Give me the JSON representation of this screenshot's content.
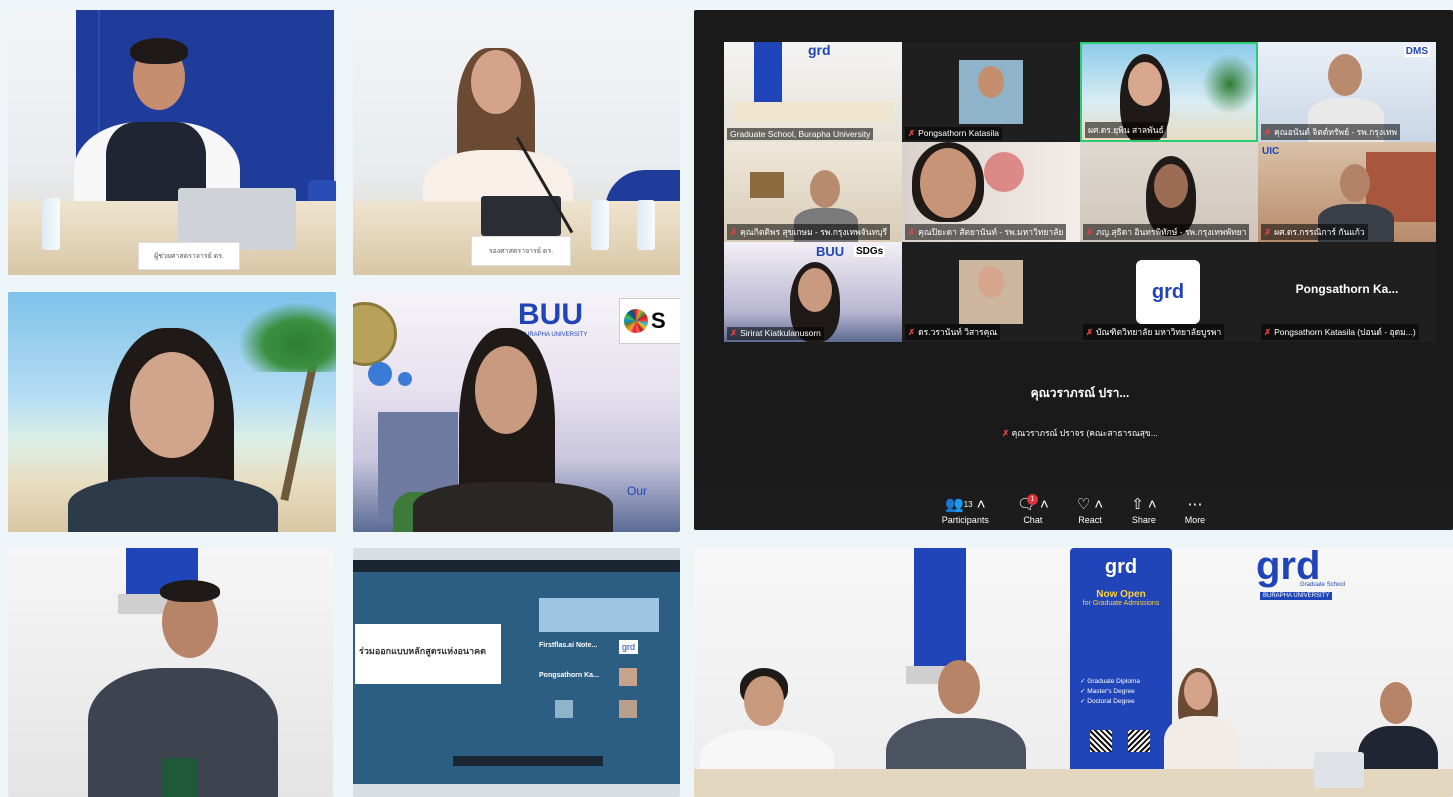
{
  "tiles": {
    "tl_nameplate": "ผู้ช่วยศาสตราจารย์ ดร.",
    "tm_nameplate": "รองศาสตราจารย์ ดร.",
    "buu_logo_text": "BUU",
    "buu_sub": "BURAPHA UNIVERSITY",
    "buu_sdg": "S",
    "buu_our": "Our"
  },
  "zoom": {
    "participants": [
      {
        "name": "Graduate School, Burapha University"
      },
      {
        "name": "Pongsathorn Katasila"
      },
      {
        "name": "ผศ.ดร.ยุพิน สาลพันธ์"
      },
      {
        "name": "คุณอนันต์ จิตต์ทรัพย์ - รพ.กรุงเทพ"
      },
      {
        "name": "คุณกิตติพร สุขเกษม - รพ.กรุงเทพจันทบุรี"
      },
      {
        "name": "คุณปิยะดา สัตยานันท์ - รพ.มหาวิทยาลัย"
      },
      {
        "name": "ภญ.สุธิดา อินทรพิทักษ์ - รพ.กรุงเทพพัทยา"
      },
      {
        "name": "ผศ.ดร.กรรณิการ์ กันแก้ว"
      },
      {
        "name": "Sirirat Kiatkulanusorn"
      },
      {
        "name": "ดร.วรานันท์ วิสารคุณ"
      },
      {
        "name": "บัณฑิตวิทยาลัย มหาวิทยาลัยบูรพา"
      },
      {
        "name": "Pongsathorn Katasila (ปอนด์ - อุดม...)"
      }
    ],
    "big_name_1": "Pongsathorn  Ka...",
    "center_name": "คุณวราภรณ์ ปรา...",
    "center_label": "คุณวราภรณ์ ปราจร (คณะสาธารณสุข...",
    "grd_logo": "grd",
    "dms_logo": "DMS",
    "uic_logo": "UIC",
    "sdgs_logo": "SDGs",
    "buu_logo": "BUU",
    "toolbar": {
      "participants_label": "Participants",
      "participants_count": "13",
      "chat_label": "Chat",
      "chat_badge": "1",
      "react_label": "React",
      "share_label": "Share",
      "more_label": "More"
    }
  },
  "tv": {
    "slide_title": "ร่วมออกแบบหลักสูตรแห่งอนาคต",
    "name1": "Firstflas.ai  Note...",
    "name2": "Pongsathorn  Ka...",
    "grd": "grd"
  },
  "room": {
    "banner_logo": "grd",
    "banner_title": "Now Open",
    "banner_sub": "for Graduate Admissions",
    "banner_list": [
      "Graduate Diploma",
      "Master's Degree",
      "Doctoral Degree"
    ],
    "wall_logo": "grd",
    "wall_sub1": "Graduate School",
    "wall_sub2": "BURAPHA UNIVERSITY"
  },
  "colors": {
    "zoom_bg": "#1a1a1a",
    "brand_blue": "#1f45b8",
    "active_border": "#2ecc71"
  }
}
